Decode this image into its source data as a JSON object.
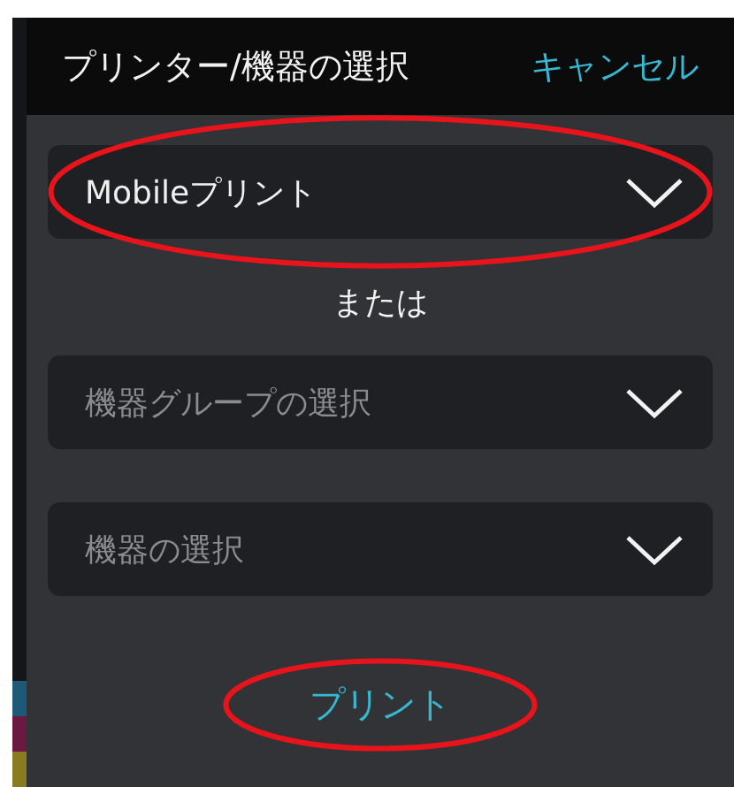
{
  "dialog": {
    "title": "プリンター/機器の選択",
    "cancel": "キャンセル"
  },
  "selects": [
    {
      "value": "Mobileプリント",
      "circled": true
    },
    {
      "label": "または"
    },
    {
      "placeholder": "機器グループの選択",
      "circled": false
    },
    {
      "placeholder": "機器の選択",
      "circled": false
    }
  ],
  "print_button": {
    "label": "プリント",
    "circled": true
  }
}
